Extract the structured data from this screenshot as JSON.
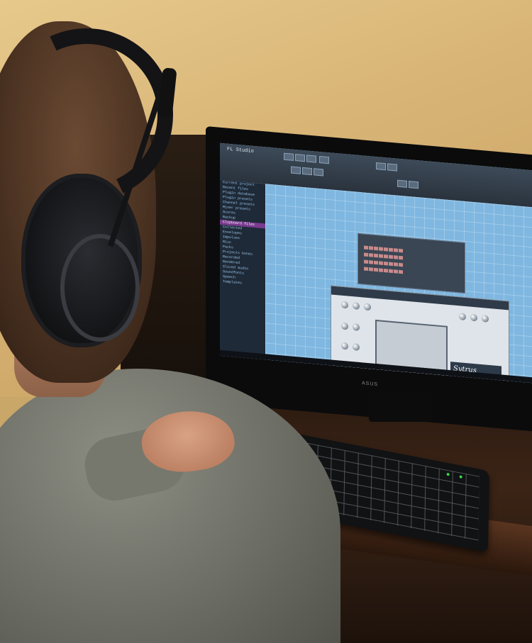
{
  "scene": {
    "description_ref": "photo",
    "screen": {
      "title_text": "FL Studio"
    },
    "browser": {
      "items": [
        "Current project",
        "Recent files",
        "Plugin database",
        "Plugin presets",
        "Channel presets",
        "Mixer presets",
        "Scores",
        "Backup",
        "Clipboard files",
        "Collected",
        "Envelopes",
        "Impulses",
        "Misc",
        "Packs",
        "Projects bones",
        "Recorded",
        "Rendered",
        "Sliced audio",
        "Soundfonts",
        "Speech",
        "Templates"
      ],
      "selected_index": 8
    },
    "synth": {
      "logo": "Sytrus"
    },
    "monitor_brand": "ASUS"
  },
  "colors": {
    "wall": "#d8b577",
    "screen_bg": "#a8cde8",
    "browser_bg": "#1e2a38",
    "selection": "#7a3b8f",
    "sweater": "#6b6c63",
    "led": "#3ad64b"
  }
}
